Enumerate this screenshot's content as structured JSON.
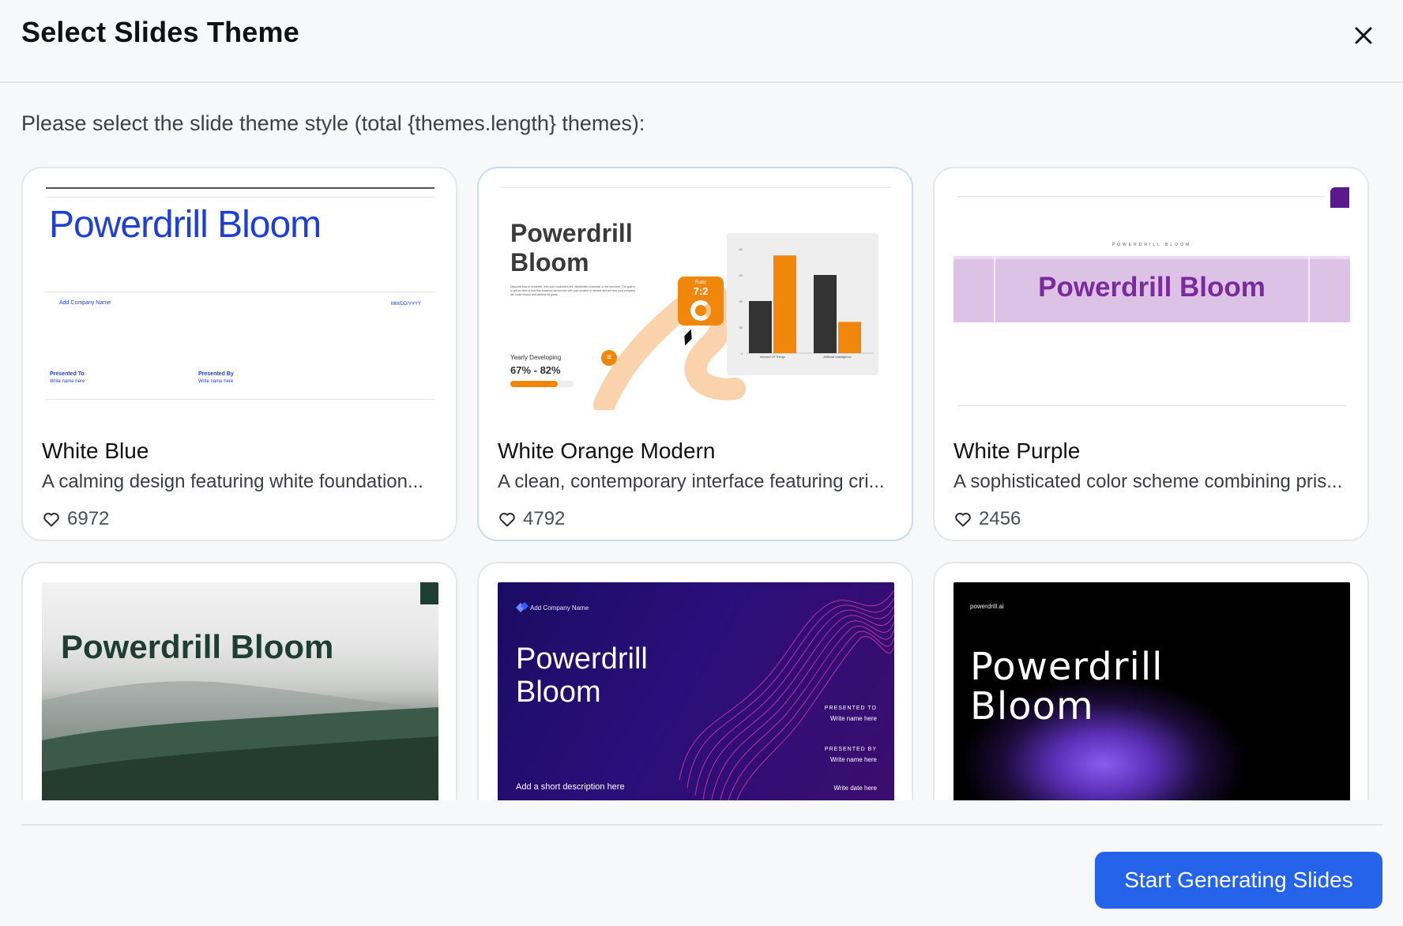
{
  "dialog": {
    "title": "Select Slides Theme",
    "subtitle": "Please select the slide theme style (total {themes.length} themes):",
    "close_icon": "close-icon",
    "primary_button": "Start Generating Slides"
  },
  "colors": {
    "accent": "#2563eb",
    "white_blue": "#1d3fd6",
    "orange": "#f0860a",
    "purple": "#7b2a9e",
    "green": "#1e3d33",
    "navy": "#1a0c63"
  },
  "themes": [
    {
      "name": "White Blue",
      "description": "A calming design featuring white foundation...",
      "likes": "6972",
      "preview": {
        "title": "Powerdrill Bloom",
        "company": "Add Company Name",
        "date": "MM/DD/YYYY",
        "presented_to_label": "Presented To",
        "presented_to_value": "Write name here",
        "presented_by_label": "Presented By",
        "presented_by_value": "Write name here"
      }
    },
    {
      "name": "White Orange Modern",
      "description": "A clean, contemporary interface featuring cri...",
      "likes": "4792",
      "preview": {
        "title_line1": "Powerdrill",
        "title_line2": "Bloom",
        "body": "Describe how to monetize, who your customers are, distribution channels, or fee structure. The goal is to get an idea of how this business will survive with your product or service and tell how your company will make money and achieve its goals.",
        "ratio_label": "Ratio",
        "ratio_value": "7:2",
        "yearly_label": "Yearly Developing",
        "yearly_value": "67% - 82%",
        "yearly_progress": 0.75,
        "chart_categories": [
          "Internet Of Things",
          "Artificial Intelligence"
        ],
        "chart_series_dark": [
          40,
          60
        ],
        "chart_series_orange": [
          75,
          24
        ],
        "chart_ticks": [
          "80",
          "60",
          "40",
          "20",
          "0"
        ]
      }
    },
    {
      "name": "White Purple",
      "description": "A sophisticated color scheme combining pris...",
      "likes": "2456",
      "preview": {
        "small_caption": "POWERDRILL BLOOM",
        "title": "Powerdrill Bloom"
      }
    },
    {
      "preview": {
        "title": "Powerdrill Bloom"
      }
    },
    {
      "preview": {
        "company": "Add Company Name",
        "title_line1": "Powerdrill",
        "title_line2": "Bloom",
        "presented_to_label": "PRESENTED TO",
        "presented_to_value": "Write name here",
        "presented_by_label": "PRESENTED BY",
        "presented_by_value": "Write name here",
        "description": "Add a short description here",
        "date": "Write date here"
      }
    },
    {
      "preview": {
        "site": "powerdrill.ai",
        "title_line1": "Powerdrill",
        "title_line2": "Bloom"
      }
    }
  ]
}
